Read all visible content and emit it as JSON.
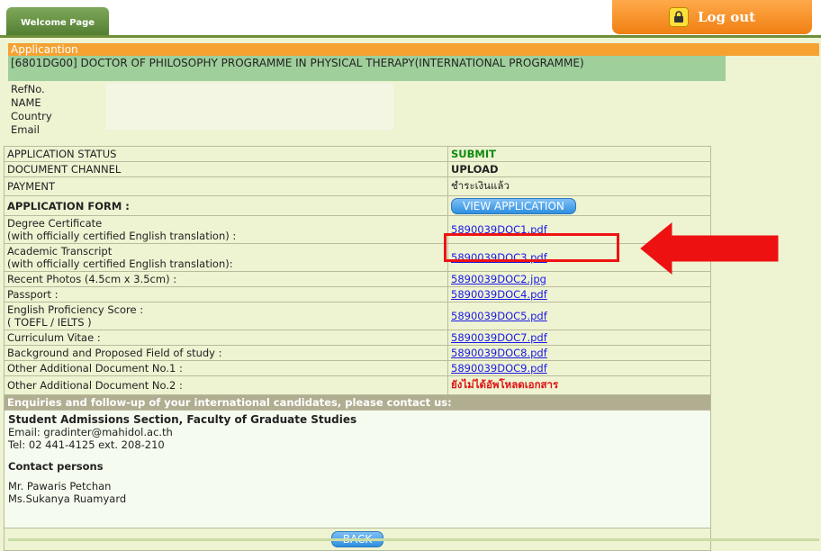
{
  "header": {
    "welcome_tab": "Welcome Page",
    "logout_label": "Log out"
  },
  "section_title": "Applicantion",
  "program": "[6801DG00] DOCTOR OF PHILOSOPHY PROGRAMME IN PHYSICAL THERAPY(INTERNATIONAL PROGRAMME)",
  "applicant_labels": {
    "refno": "RefNo.",
    "name": "NAME",
    "country": "Country",
    "email": "Email"
  },
  "status_rows": [
    {
      "label": "APPLICATION STATUS",
      "value": "SUBMIT"
    },
    {
      "label": "DOCUMENT CHANNEL",
      "value": "UPLOAD"
    },
    {
      "label": "PAYMENT",
      "value": "ชำระเงินแล้ว"
    },
    {
      "label": "APPLICATION FORM :",
      "button": "VIEW APPLICATION"
    }
  ],
  "documents": [
    {
      "label1": "Degree Certificate",
      "label2": "(with officially certified English translation) :",
      "file": "5890039DOC1.pdf"
    },
    {
      "label1": "Academic Transcript",
      "label2": "(with officially certified English translation):",
      "file": "5890039DOC3.pdf"
    },
    {
      "label1": "Recent Photos (4.5cm x 3.5cm) :",
      "file": "5890039DOC2.jpg"
    },
    {
      "label1": "Passport :",
      "file": "5890039DOC4.pdf"
    },
    {
      "label1": "English Proficiency Score :",
      "label2": "( TOEFL / IELTS )",
      "file": "5890039DOC5.pdf"
    },
    {
      "label1": "Curriculum Vitae :",
      "file": "5890039DOC7.pdf"
    },
    {
      "label1": "Background and Proposed Field of study :",
      "file": "5890039DOC8.pdf"
    },
    {
      "label1": "Other Additional Document No.1 :",
      "file": "5890039DOC9.pdf"
    },
    {
      "label1": "Other Additional Document No.2 :",
      "not_uploaded": "ยังไม่ได้อัพโหลดเอกสาร"
    }
  ],
  "enquiry": {
    "header": "Enquiries and follow-up of your international candidates, please contact us:",
    "org": "Student Admissions Section, Faculty of Graduate Studies",
    "email": "Email: gradinter@mahidol.ac.th",
    "tel": "Tel: 02 441-4125 ext. 208-210",
    "contacts_title": "Contact persons",
    "person1": "Mr. Pawaris Petchan",
    "person2": "Ms.Sukanya Ruamyard"
  },
  "back_label": "BACK",
  "colors": {
    "background": "#eef3d2",
    "orange": "#f6a233",
    "program_green": "#9fcf9b",
    "link": "#1a1ae6",
    "highlight_red": "#ef1212"
  }
}
